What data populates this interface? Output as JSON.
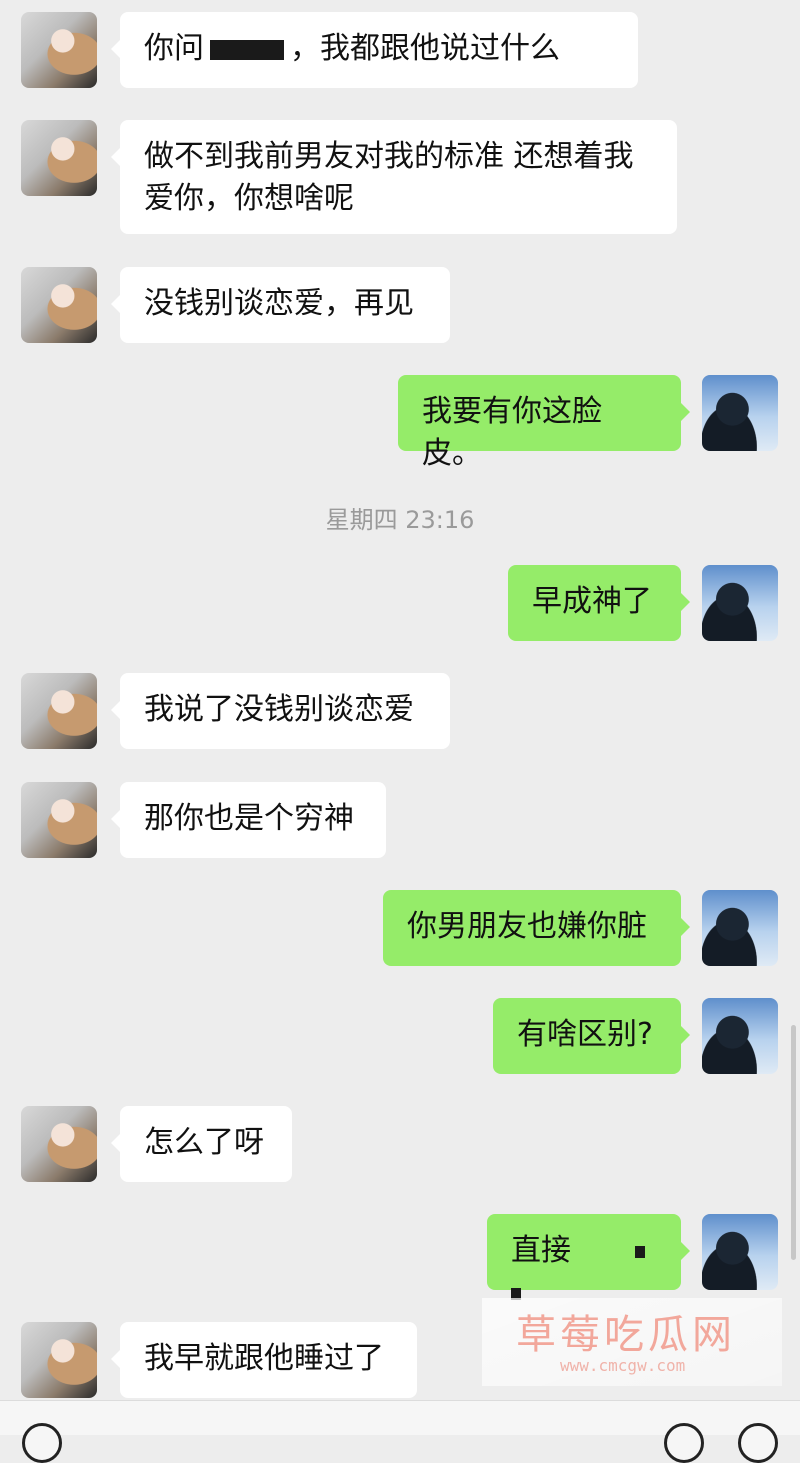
{
  "timestamp": "星期四 23:16",
  "messages": [
    {
      "side": "left",
      "part1": "你问",
      "part2": "，我都跟他说过什么"
    },
    {
      "side": "left",
      "line1": "做不到我前男友对我的标准 还想着我",
      "line2": "爱你，你想啥呢"
    },
    {
      "side": "left",
      "text": "没钱别谈恋爱，再见"
    },
    {
      "side": "right",
      "text": "我要有你这脸皮。"
    },
    {
      "side": "right",
      "text": "早成神了"
    },
    {
      "side": "left",
      "text": "我说了没钱别谈恋爱"
    },
    {
      "side": "left",
      "text": "那你也是个穷神"
    },
    {
      "side": "right",
      "text": "你男朋友也嫌你脏"
    },
    {
      "side": "right",
      "text": "有啥区别?"
    },
    {
      "side": "left",
      "text": "怎么了呀"
    },
    {
      "side": "right",
      "text": "直接"
    },
    {
      "side": "left",
      "text": "我早就跟他睡过了"
    }
  ],
  "watermark": {
    "title": "草莓吃瓜网",
    "url": "www.cmcgw.com"
  },
  "colors": {
    "background": "#ededed",
    "sent_bubble": "#95ec69",
    "received_bubble": "#ffffff"
  },
  "avatars": {
    "left": "girl-avatar",
    "right": "boy-avatar"
  }
}
